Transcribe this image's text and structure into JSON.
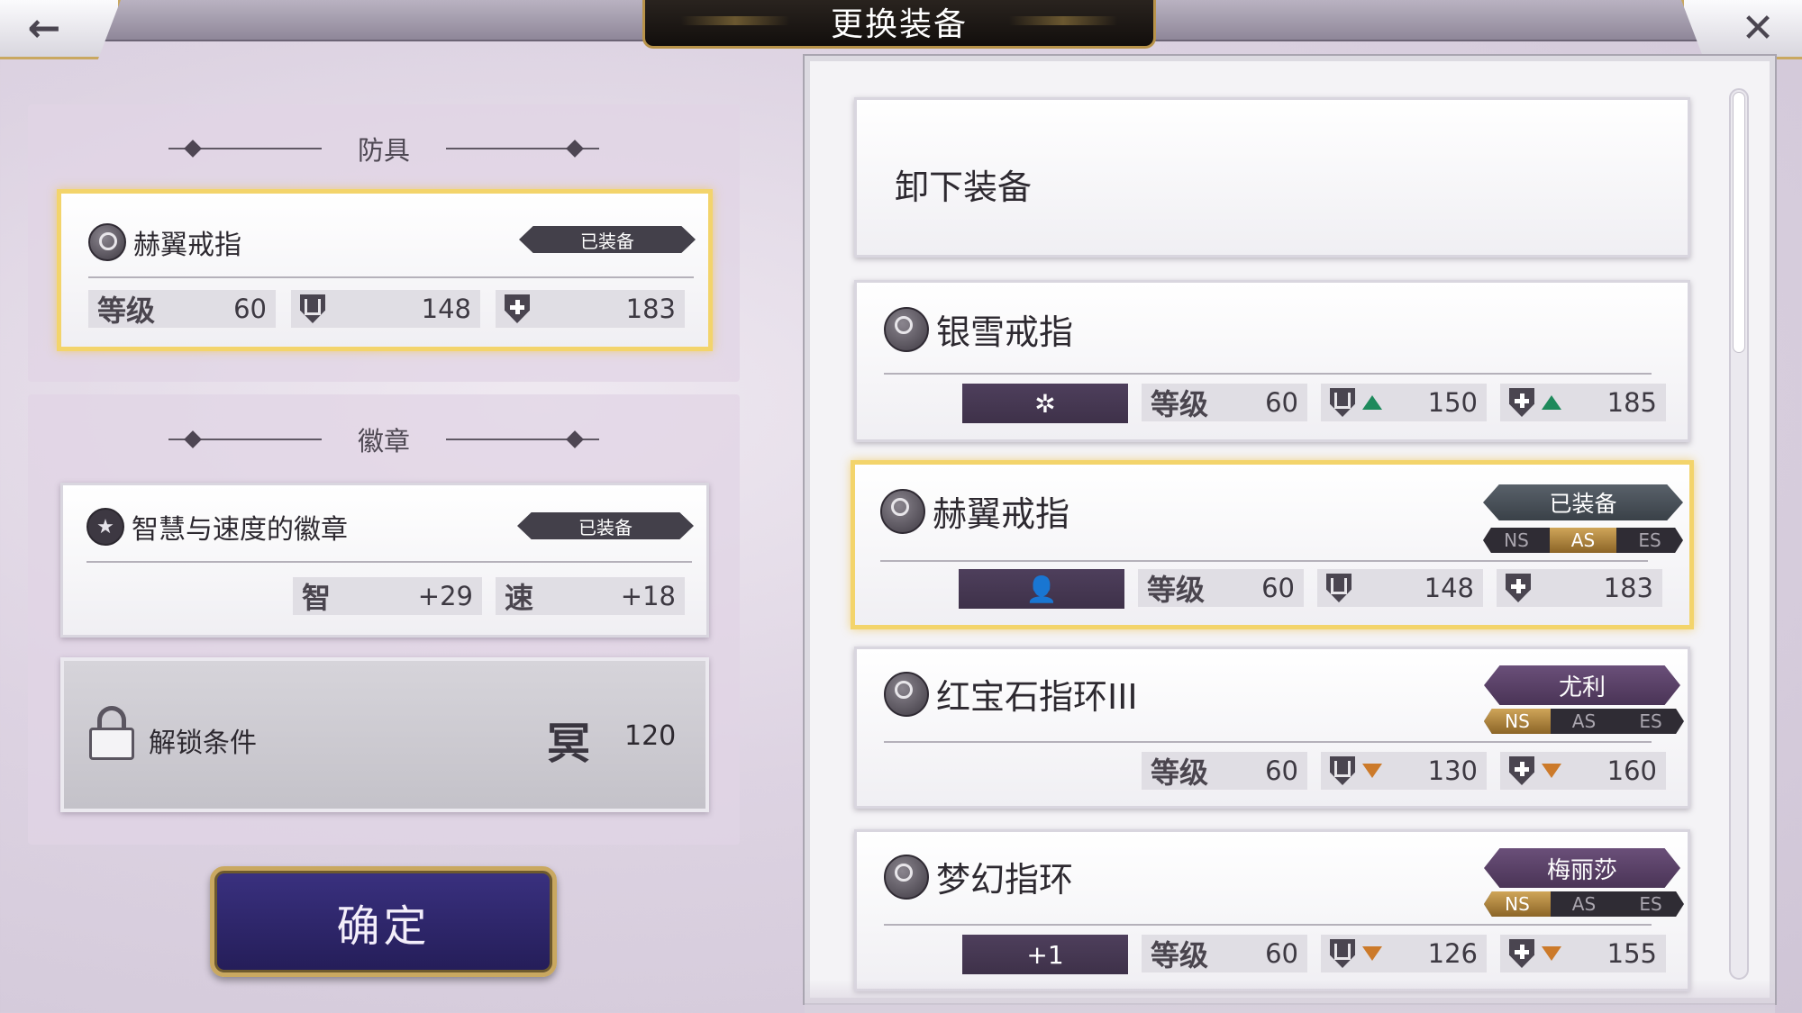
{
  "header": {
    "title": "更换装备",
    "back_icon": "←",
    "close_icon": "✕"
  },
  "left": {
    "armor_section": "防具",
    "armor_card": {
      "name": "赫翼戒指",
      "tag": "已装备",
      "level_label": "等级",
      "level": "60",
      "def": "148",
      "mdef": "183"
    },
    "badge_section": "徽章",
    "badge_card": {
      "name": "智慧与速度的徽章",
      "tag": "已装备",
      "stat1_label": "智",
      "stat1": "+29",
      "stat2_label": "速",
      "stat2": "+18"
    },
    "lock_card": {
      "label": "解锁条件",
      "req_icon": "冥",
      "req_value": "120"
    },
    "confirm": "确定"
  },
  "list": {
    "unequip": "卸下装备",
    "items": [
      {
        "name": "银雪戒指",
        "box": "✲",
        "level_label": "等级",
        "level": "60",
        "def": "150",
        "mdef": "185",
        "trend": "up"
      },
      {
        "name": "赫翼戒指",
        "tag": "已装备",
        "series": [
          "NS",
          "AS",
          "ES"
        ],
        "series_active": "AS",
        "box": "👤",
        "level_label": "等级",
        "level": "60",
        "def": "148",
        "mdef": "183",
        "trend": "none"
      },
      {
        "name": "红宝石指环III",
        "tag": "尤利",
        "series": [
          "NS",
          "AS",
          "ES"
        ],
        "series_active": "NS",
        "level_label": "等级",
        "level": "60",
        "def": "130",
        "mdef": "160",
        "trend": "down"
      },
      {
        "name": "梦幻指环",
        "tag": "梅丽莎",
        "series": [
          "NS",
          "AS",
          "ES"
        ],
        "series_active": "NS",
        "box": "+1",
        "level_label": "等级",
        "level": "60",
        "def": "126",
        "mdef": "155",
        "trend": "down"
      }
    ]
  },
  "colors": {
    "accent_gold": "#f3d46b",
    "up": "#1e8a5c",
    "down": "#cc7a2a",
    "char_tag": "#4a3456"
  }
}
